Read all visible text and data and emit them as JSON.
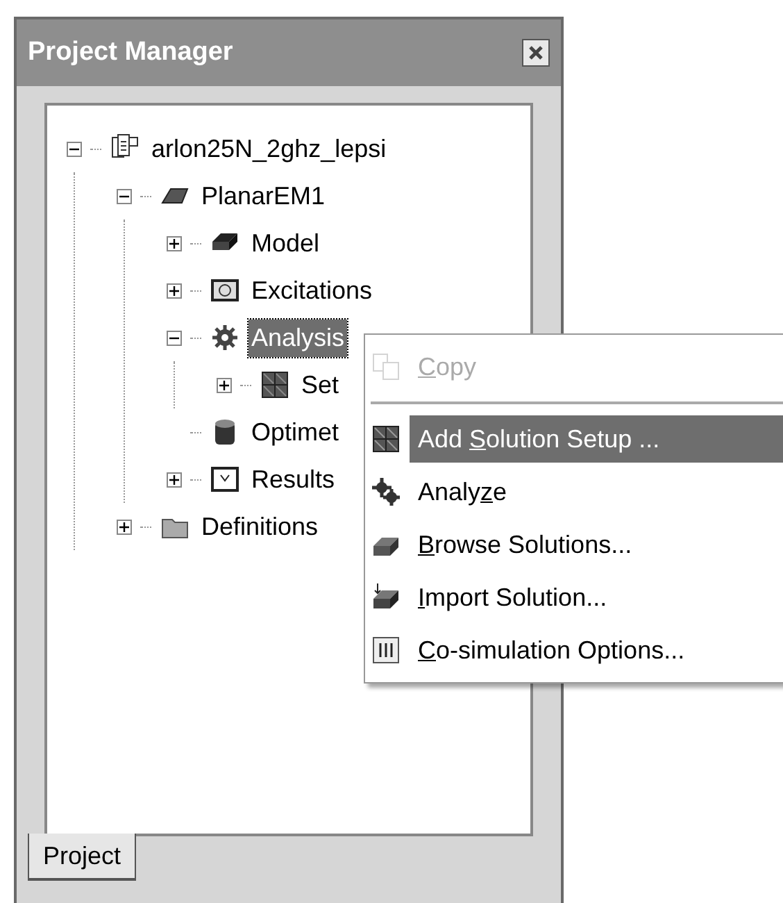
{
  "panel": {
    "title": "Project Manager"
  },
  "tree": [
    {
      "label": "arlon25N_2ghz_lepsi",
      "kind": "project",
      "expanded": true,
      "selected": false,
      "children": [
        {
          "label": "PlanarEM1",
          "kind": "design",
          "expanded": true,
          "selected": false,
          "children": [
            {
              "label": "Model",
              "kind": "model",
              "expanded": false,
              "selected": false
            },
            {
              "label": "Excitations",
              "kind": "excitations",
              "expanded": false,
              "selected": false
            },
            {
              "label": "Analysis",
              "kind": "analysis",
              "expanded": true,
              "selected": true,
              "children": [
                {
                  "label": "Set",
                  "kind": "setup",
                  "expanded": false,
                  "selected": false
                }
              ]
            },
            {
              "label": "Optimet",
              "kind": "optimetrics",
              "selected": false
            },
            {
              "label": "Results",
              "kind": "results",
              "expanded": false,
              "selected": false
            }
          ]
        },
        {
          "label": "Definitions",
          "kind": "definitions",
          "expanded": false,
          "selected": false
        }
      ]
    }
  ],
  "context_menu": [
    {
      "kind": "copy",
      "mnemonic": "C",
      "label_after": "opy",
      "disabled": true,
      "selected": false
    },
    {
      "kind": "separator"
    },
    {
      "kind": "add_setup",
      "label_before": "Add ",
      "mnemonic": "S",
      "label_after": "olution Setup ...",
      "disabled": false,
      "selected": true
    },
    {
      "kind": "analyze",
      "label_before": "Analy",
      "mnemonic": "z",
      "label_after": "e",
      "disabled": false,
      "selected": false
    },
    {
      "kind": "browse",
      "mnemonic": "B",
      "label_after": "rowse Solutions...",
      "disabled": false,
      "selected": false
    },
    {
      "kind": "import",
      "mnemonic": "I",
      "label_after": "mport Solution...",
      "disabled": false,
      "selected": false
    },
    {
      "kind": "cosim",
      "mnemonic": "C",
      "label_after": "o-simulation Options...",
      "disabled": false,
      "selected": false
    }
  ],
  "tabs": [
    {
      "label": "Project",
      "selected": true
    }
  ]
}
